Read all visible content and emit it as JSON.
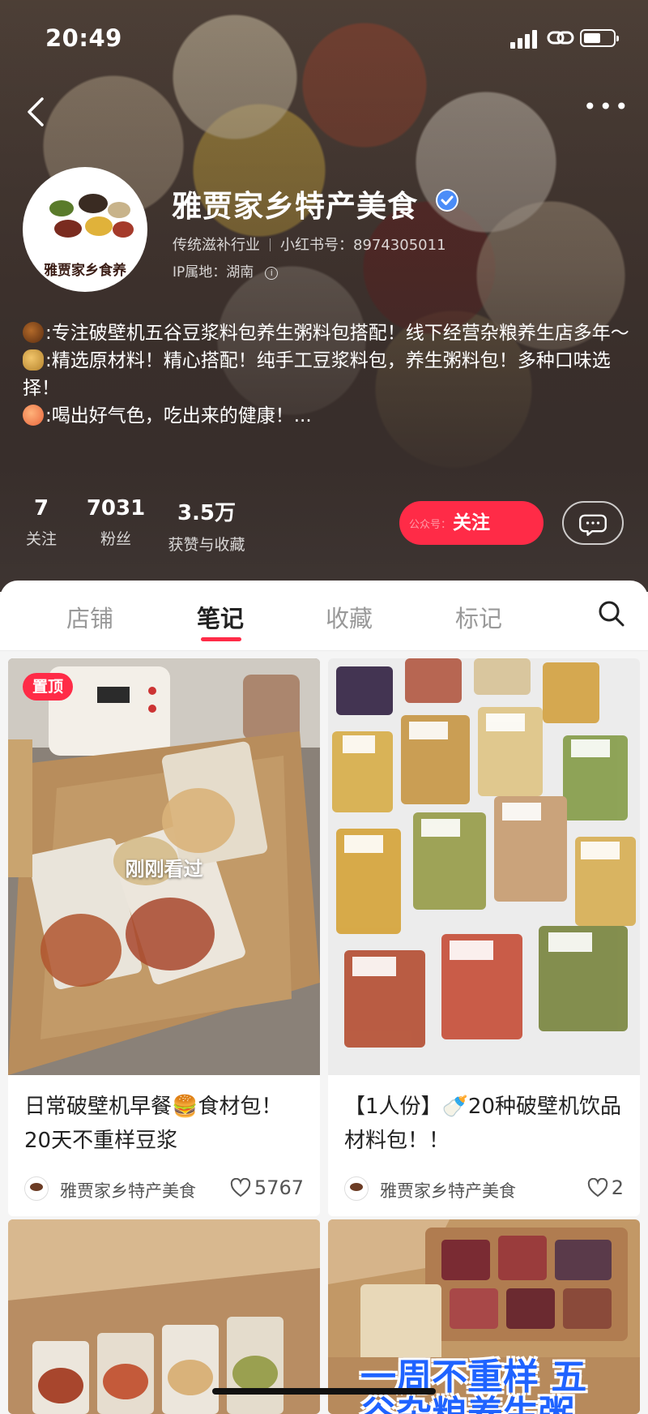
{
  "status_bar": {
    "time": "20:49"
  },
  "profile": {
    "name": "雅贾家乡特产美食",
    "category": "传统滋补行业",
    "id_label": "小红书号：8974305011",
    "ip_label": "IP属地：湖南",
    "avatar_text": "雅贾家乡食养",
    "bio_lines": [
      ":专注破壁机五谷豆浆料包养生粥料包搭配！线下经营杂粮养生店多年～",
      ":精选原材料！精心搭配！纯手工豆浆料包，养生粥料包！多种口味选择！",
      ":喝出好气色，吃出来的健康！..."
    ],
    "stats": [
      {
        "value": "7",
        "label": "关注"
      },
      {
        "value": "7031",
        "label": "粉丝"
      },
      {
        "value": "3.5万",
        "label": "获赞与收藏"
      }
    ],
    "follow_label": "关注",
    "follow_watermark": "公众号：",
    "brand_color": "#ff2b47"
  },
  "tabs": [
    {
      "label": "店铺"
    },
    {
      "label": "笔记",
      "active": true
    },
    {
      "label": "收藏"
    },
    {
      "label": "标记"
    }
  ],
  "notes": [
    {
      "pinned_label": "置顶",
      "seen_label": "刚刚看过",
      "title": "日常破壁机早餐🍔食材包！20天不重样豆浆",
      "author": "雅贾家乡特产美食",
      "likes": "5767"
    },
    {
      "title": "【1人份】🍼20种破壁机饮品材料包！！",
      "author": "雅贾家乡特产美食",
      "likes": "2"
    },
    {
      "image": "boxed-bean-packs"
    },
    {
      "overlay_text": "一周不重样 五谷杂粮养生粥"
    }
  ]
}
